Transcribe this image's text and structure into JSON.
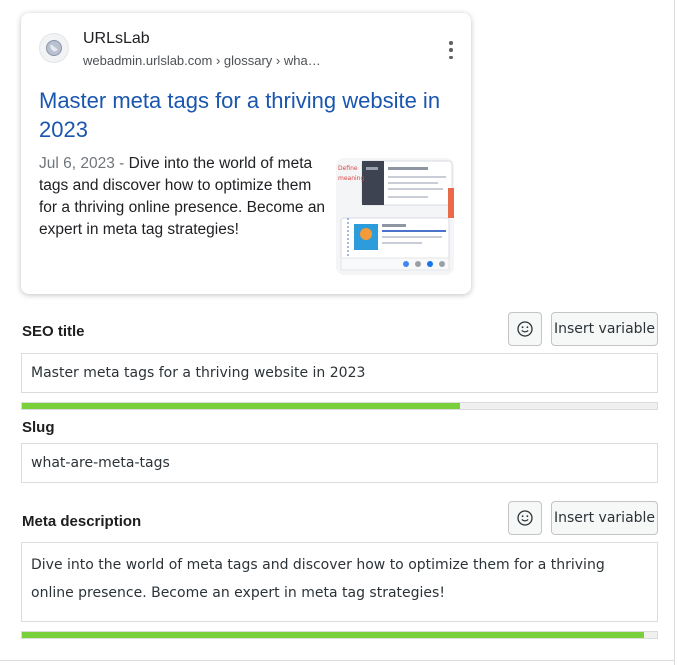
{
  "snippet": {
    "site_name": "URLsLab",
    "site_url": "webadmin.urlslab.com › glossary › wha…",
    "title": "Master meta tags for a thriving website in 2023",
    "date": "Jul 6, 2023",
    "separator": " - ",
    "description": "Dive into the world of meta tags and discover how to optimize them for a thriving online presence. Become an expert in meta tag strategies!"
  },
  "seo_title": {
    "label": "SEO title",
    "insert_label": "Insert variable",
    "value": "Master meta tags for a thriving website in 2023",
    "progress": 0.69
  },
  "slug": {
    "label": "Slug",
    "value": "what-are-meta-tags"
  },
  "meta_description": {
    "label": "Meta description",
    "insert_label": "Insert variable",
    "value": "Dive into the world of meta tags and discover how to optimize them for a thriving online presence. Become an expert in meta tag strategies!",
    "progress": 0.98
  },
  "colors": {
    "link": "#1a56b0",
    "progress_good": "#7ad03a"
  },
  "icons": [
    "globe-icon",
    "more-vertical-icon",
    "emoji-icon"
  ]
}
